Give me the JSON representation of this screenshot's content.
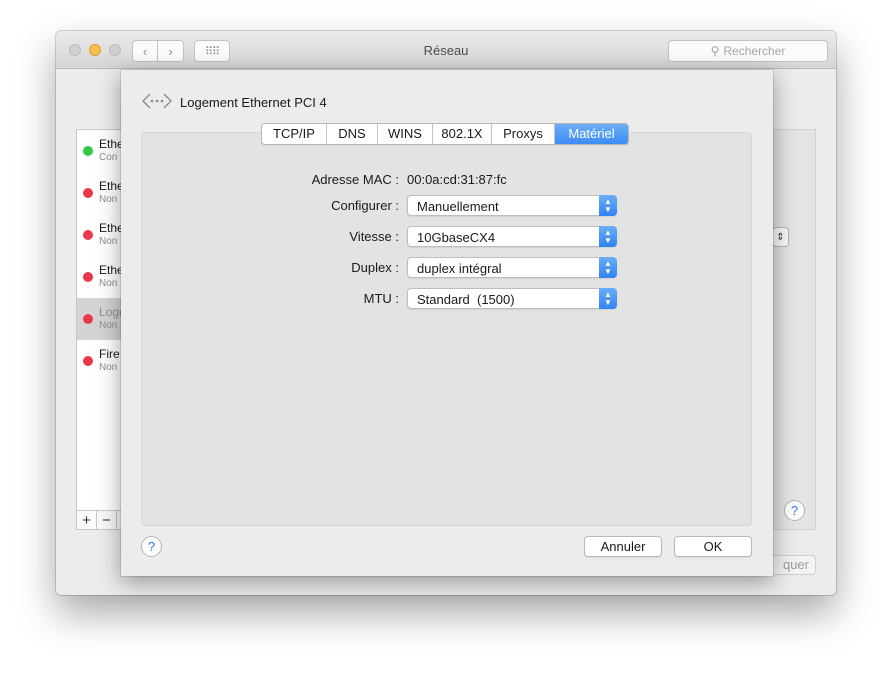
{
  "window": {
    "title": "Réseau",
    "search_placeholder": "Rechercher",
    "nav_back": "‹",
    "nav_forward": "›",
    "nav_grid": "⠿⠿"
  },
  "sidebar": {
    "services": [
      {
        "name": "Ethe",
        "status": "Con",
        "status_color": "#34c84a",
        "selected": false
      },
      {
        "name": "Ethe",
        "status": "Non",
        "status_color": "#e9384c",
        "selected": false
      },
      {
        "name": "Ethe",
        "status": "Non",
        "status_color": "#e9384c",
        "selected": false
      },
      {
        "name": "Ethe",
        "status": "Non",
        "status_color": "#e9384c",
        "selected": false
      },
      {
        "name": "Loge",
        "status": "Non",
        "status_color": "#e9384c",
        "selected": true
      },
      {
        "name": "Fire",
        "status": "Non",
        "status_color": "#e9384c",
        "selected": false
      }
    ],
    "add_label": "+",
    "remove_label": "−"
  },
  "background": {
    "help_label": "?",
    "apply_label": "quer",
    "updown_label": "⇕"
  },
  "sheet": {
    "title": "Logement Ethernet PCI 4",
    "tabs": [
      {
        "label": "TCP/IP",
        "active": false
      },
      {
        "label": "DNS",
        "active": false
      },
      {
        "label": "WINS",
        "active": false
      },
      {
        "label": "802.1X",
        "active": false
      },
      {
        "label": "Proxys",
        "active": false
      },
      {
        "label": "Matériel",
        "active": true
      }
    ],
    "form": {
      "mac_label": "Adresse MAC :",
      "mac_value": "00:0a:cd:31:87:fc",
      "configure_label": "Configurer :",
      "configure_value": "Manuellement",
      "speed_label": "Vitesse :",
      "speed_value": "10GbaseCX4",
      "duplex_label": "Duplex :",
      "duplex_value": "duplex intégral",
      "mtu_label": "MTU :",
      "mtu_value": "Standard  (1500)"
    },
    "help_label": "?",
    "cancel_label": "Annuler",
    "ok_label": "OK"
  },
  "colors": {
    "accent": "#3d8cf5",
    "connected": "#34c84a",
    "disconnected": "#e9384c",
    "minimize": "#f5be4f"
  }
}
